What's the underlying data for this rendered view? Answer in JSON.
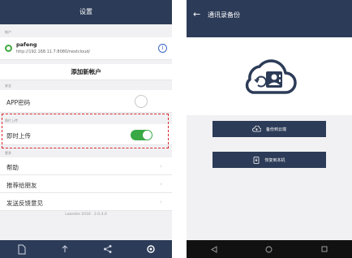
{
  "left": {
    "title": "设置",
    "account_section": "帐户",
    "account": {
      "name": "pafeng",
      "url": "http://192.168.11.7:8080/nextcloud/"
    },
    "add_account": "添加新帐户",
    "section_2": "安全",
    "app_lock": "APP密码",
    "photo_section": "照片上传",
    "photo_upload": "即时上传",
    "section_3": "更多",
    "help": "帮助",
    "recommend": "推荐给朋友",
    "feedback": "发送反馈意见",
    "version": "Lakesite 2016 · 2.0.4.0",
    "tabs": [
      "files-icon",
      "upload-icon",
      "share-icon",
      "settings-icon"
    ]
  },
  "right": {
    "title": "通讯录备份",
    "backup_label": "备份到云端",
    "restore_label": "恢复到本机"
  },
  "colors": {
    "navy": "#2c3b57",
    "toggle": "#3aa845",
    "highlight": "#d8282d"
  }
}
